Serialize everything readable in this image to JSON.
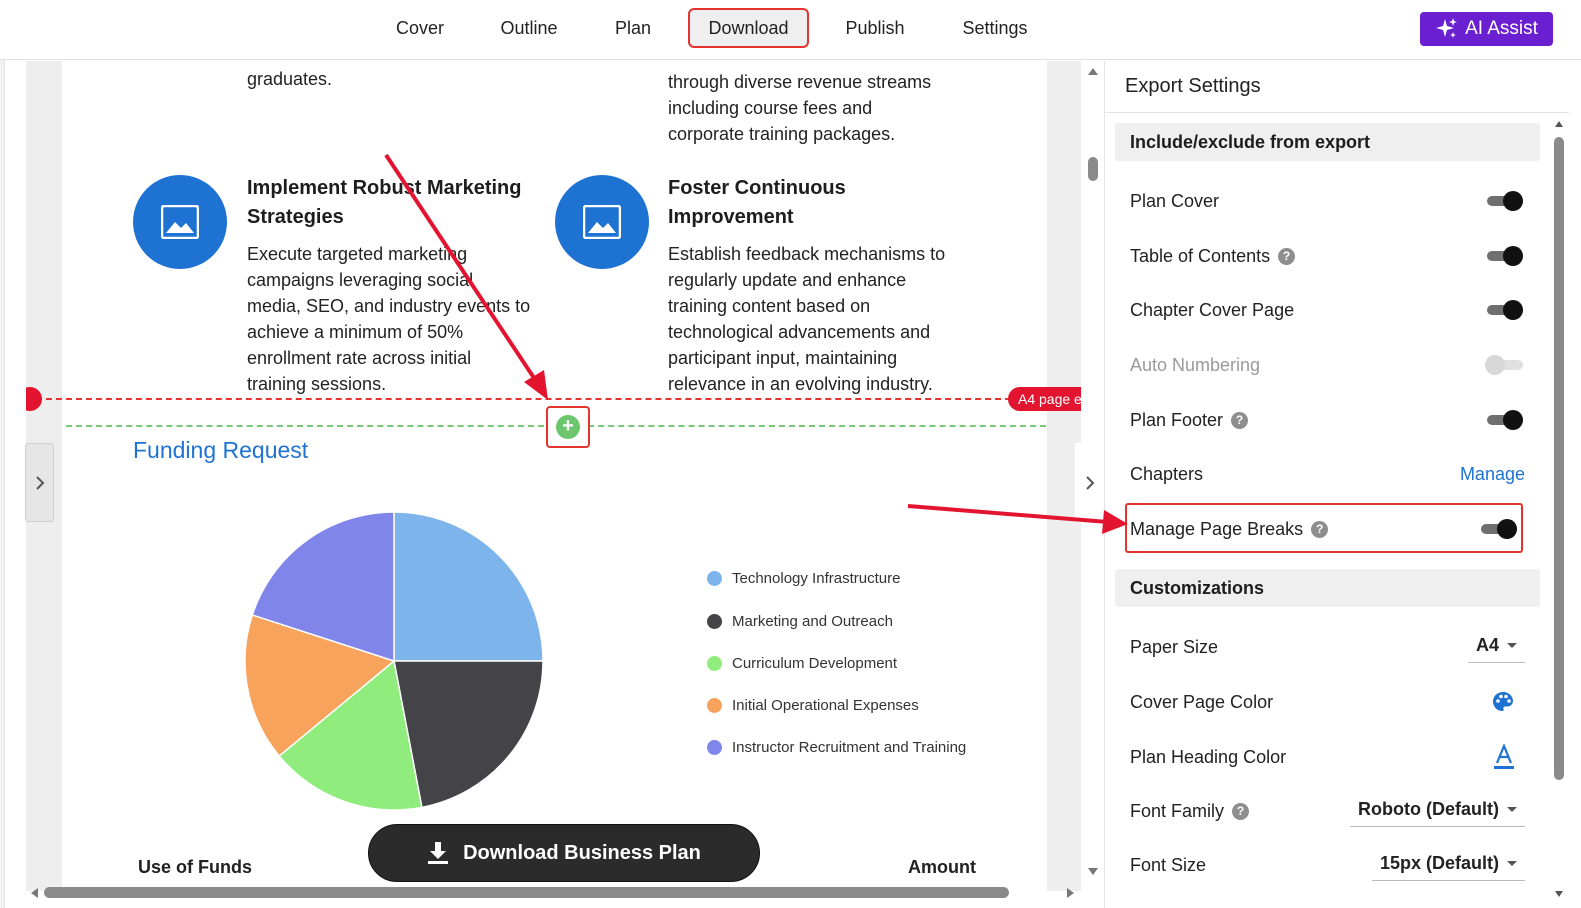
{
  "tabs": [
    {
      "label": "Cover"
    },
    {
      "label": "Outline"
    },
    {
      "label": "Plan"
    },
    {
      "label": "Download",
      "active": true
    },
    {
      "label": "Publish"
    },
    {
      "label": "Settings"
    }
  ],
  "ai_assist": {
    "label": "AI Assist",
    "icon": "sparkles-icon",
    "color": "#6a1fd0"
  },
  "document": {
    "top_left_text": "graduates.",
    "top_right_text": [
      "through diverse revenue streams",
      "including course fees and",
      "corporate training packages."
    ],
    "cards": [
      {
        "title": [
          "Implement Robust Marketing",
          "Strategies"
        ],
        "body": [
          "Execute targeted marketing",
          "campaigns leveraging social",
          "media, SEO, and industry events to",
          "achieve a minimum of 50%",
          "enrollment rate across initial",
          "training sessions."
        ],
        "icon": "image-icon"
      },
      {
        "title": [
          "Foster Continuous",
          "Improvement"
        ],
        "body": [
          "Establish feedback mechanisms to",
          "regularly update and enhance",
          "training content based on",
          "technological advancements and",
          "participant input, maintaining",
          "relevance in an evolving industry."
        ],
        "icon": "image-icon"
      }
    ],
    "page_break_tag": "A4 page e",
    "section_title": "Funding Request",
    "table_headers": {
      "left": "Use of Funds",
      "right": "Amount"
    }
  },
  "chart_data": {
    "type": "pie",
    "title": "",
    "series": [
      {
        "name": "Technology Infrastructure",
        "value": 25,
        "color": "#7db4ec"
      },
      {
        "name": "Marketing and Outreach",
        "value": 22,
        "color": "#434348"
      },
      {
        "name": "Curriculum Development",
        "value": 17,
        "color": "#90ed7d"
      },
      {
        "name": "Initial Operational Expenses",
        "value": 16,
        "color": "#f7a35c"
      },
      {
        "name": "Instructor Recruitment and Training",
        "value": 20,
        "color": "#8085e9"
      }
    ],
    "legend_position": "right"
  },
  "download_button": {
    "label": "Download Business Plan",
    "icon": "download-icon"
  },
  "export_panel": {
    "title": "Export Settings",
    "include_section": "Include/exclude from export",
    "toggles": [
      {
        "label": "Plan Cover",
        "on": true,
        "help": false,
        "disabled": false
      },
      {
        "label": "Table of Contents",
        "on": true,
        "help": true,
        "disabled": false
      },
      {
        "label": "Chapter Cover Page",
        "on": true,
        "help": false,
        "disabled": false
      },
      {
        "label": "Auto Numbering",
        "on": false,
        "help": false,
        "disabled": true
      },
      {
        "label": "Plan Footer",
        "on": true,
        "help": true,
        "disabled": false
      }
    ],
    "chapters": {
      "label": "Chapters",
      "link": "Manage"
    },
    "page_breaks": {
      "label": "Manage Page Breaks",
      "on": true
    },
    "custom_section": "Customizations",
    "paper_size": {
      "label": "Paper Size",
      "value": "A4"
    },
    "cover_color": {
      "label": "Cover Page Color",
      "icon": "palette-icon"
    },
    "heading_color": {
      "label": "Plan Heading Color",
      "icon": "text-color-icon"
    },
    "font_family": {
      "label": "Font Family",
      "value": "Roboto (Default)"
    },
    "font_size": {
      "label": "Font Size",
      "value": "15px (Default)"
    }
  }
}
